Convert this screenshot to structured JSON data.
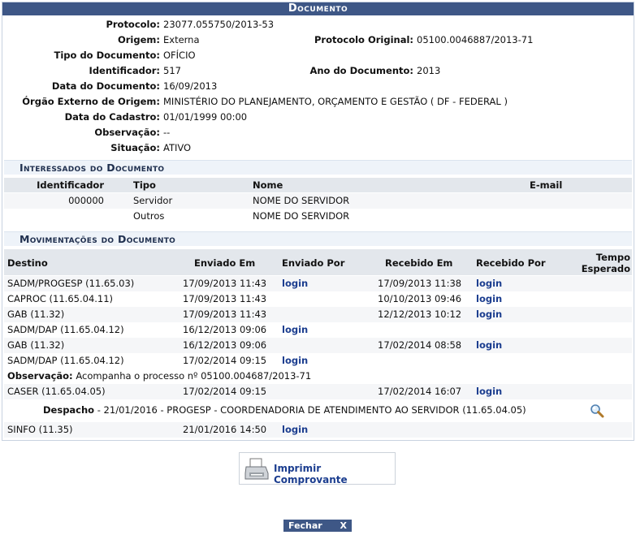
{
  "caption": "Documento",
  "fields": {
    "protocolo": {
      "label": "Protocolo:",
      "value": "23077.055750/2013-53"
    },
    "origem": {
      "label": "Origem:",
      "value": "Externa"
    },
    "protocolo_original": {
      "label": "Protocolo Original:",
      "value": "05100.0046887/2013-71"
    },
    "tipo": {
      "label": "Tipo do Documento:",
      "value": "OFÍCIO"
    },
    "identificador": {
      "label": "Identificador:",
      "value": "517"
    },
    "ano": {
      "label": "Ano do Documento:",
      "value": "2013"
    },
    "data_doc": {
      "label": "Data do Documento:",
      "value": "16/09/2013"
    },
    "orgao": {
      "label": "Órgão Externo de Origem:",
      "value": "MINISTÉRIO DO PLANEJAMENTO, ORÇAMENTO E GESTÃO ( DF - FEDERAL )"
    },
    "data_cadastro": {
      "label": "Data do Cadastro:",
      "value": "01/01/1999 00:00"
    },
    "observacao": {
      "label": "Observação:",
      "value": "--"
    },
    "situacao": {
      "label": "Situação:",
      "value": "ATIVO"
    }
  },
  "interessados": {
    "title": "Interessados do Documento",
    "headers": {
      "identificador": "Identificador",
      "tipo": "Tipo",
      "nome": "Nome",
      "email": "E-mail"
    },
    "rows": [
      {
        "identificador": "000000",
        "tipo": "Servidor",
        "nome": "NOME DO SERVIDOR",
        "email": ""
      },
      {
        "identificador": "",
        "tipo": "Outros",
        "nome": "NOME DO SERVIDOR",
        "email": ""
      }
    ]
  },
  "movimentacoes": {
    "title": "Movimentações do Documento",
    "headers": {
      "destino": "Destino",
      "enviado_em": "Enviado Em",
      "enviado_por": "Enviado Por",
      "recebido_em": "Recebido Em",
      "recebido_por": "Recebido Por",
      "tempo_1": "Tempo",
      "tempo_2": "Esperado"
    },
    "rows": [
      {
        "destino": "SADM/PROGESP (11.65.03)",
        "enviado_em": "17/09/2013 11:43",
        "enviado_por": "login",
        "recebido_em": "17/09/2013 11:38",
        "recebido_por": "login"
      },
      {
        "destino": "CAPROC (11.65.04.11)",
        "enviado_em": "17/09/2013 11:43",
        "enviado_por": "",
        "recebido_em": "10/10/2013 09:46",
        "recebido_por": "login"
      },
      {
        "destino": "GAB (11.32)",
        "enviado_em": "17/09/2013 11:43",
        "enviado_por": "",
        "recebido_em": "12/12/2013 10:12",
        "recebido_por": "login"
      },
      {
        "destino": "SADM/DAP (11.65.04.12)",
        "enviado_em": "16/12/2013 09:06",
        "enviado_por": "login",
        "recebido_em": "",
        "recebido_por": ""
      },
      {
        "destino": "GAB (11.32)",
        "enviado_em": "16/12/2013 09:06",
        "enviado_por": "",
        "recebido_em": "17/02/2014 08:58",
        "recebido_por": "login"
      },
      {
        "destino": "SADM/DAP (11.65.04.12)",
        "enviado_em": "17/02/2014 09:15",
        "enviado_por": "login",
        "recebido_em": "",
        "recebido_por": ""
      }
    ],
    "observacao": {
      "label": "Observação:",
      "value": "Acompanha o processo nº 05100.004687/2013-71"
    },
    "row_caser": {
      "destino": "CASER (11.65.04.05)",
      "enviado_em": "17/02/2014 09:15",
      "enviado_por": "",
      "recebido_em": "17/02/2014 16:07",
      "recebido_por": "login"
    },
    "despacho": {
      "label": "Despacho",
      "value": "- 21/01/2016 - PROGESP - COORDENADORIA DE ATENDIMENTO AO SERVIDOR (11.65.04.05)",
      "icon": "magnifier-icon"
    },
    "row_sinfo": {
      "destino": "SINFO (11.35)",
      "enviado_em": "21/01/2016 14:50",
      "enviado_por": "login",
      "recebido_em": "",
      "recebido_por": ""
    }
  },
  "actions": {
    "print_label": "Imprimir Comprovante",
    "close_label": "Fechar",
    "close_x": "X"
  }
}
